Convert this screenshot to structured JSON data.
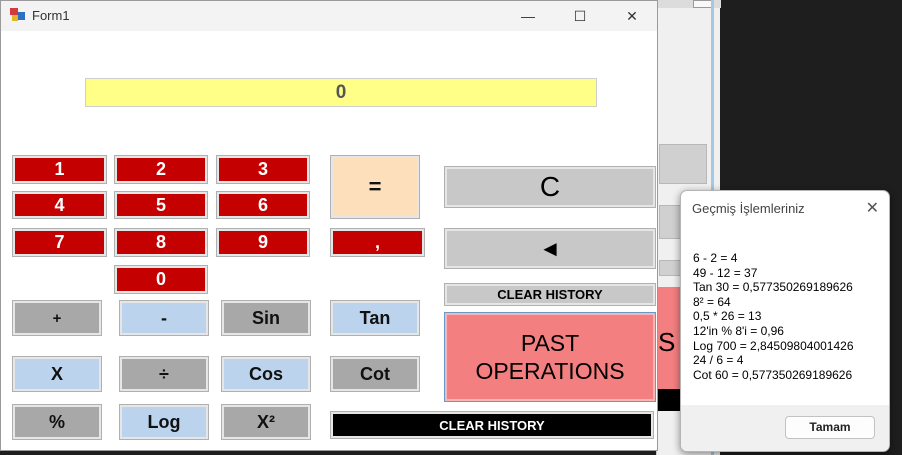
{
  "window": {
    "title": "Form1"
  },
  "title_controls": {
    "minimize": "—",
    "maximize": "☐",
    "close": "✕"
  },
  "display": {
    "value": "0"
  },
  "numpad": [
    "1",
    "2",
    "3",
    "4",
    "5",
    "6",
    "7",
    "8",
    "9",
    "0"
  ],
  "buttons": {
    "equals": "=",
    "comma": ",",
    "clear": "C",
    "backspace": "◄",
    "clear_history_1": "CLEAR HISTORY",
    "past_operations_line1": "PAST",
    "past_operations_line2": "OPERATIONS",
    "clear_history_2": "CLEAR HISTORY",
    "plus": "+",
    "minus": "-",
    "sin": "Sin",
    "tan": "Tan",
    "multiply": "X",
    "divide": "÷",
    "cos": "Cos",
    "cot": "Cot",
    "percent": "%",
    "log": "Log",
    "square": "X²"
  },
  "dialog": {
    "title": "Geçmiş İşlemleriniz",
    "close": "✕",
    "lines": [
      "6 - 2 = 4",
      "49 - 12 = 37",
      "Tan 30 = 0,577350269189626",
      "8² = 64",
      "0,5 * 26 = 13",
      "12'in % 8'i = 0,96",
      "Log 700 = 2,84509804001426",
      "24 / 6 = 4",
      "Cot 60 = 0,577350269189626"
    ],
    "ok": "Tamam"
  },
  "remnant": {
    "letter": "S"
  },
  "colors": {
    "display_bg": "#ffff88",
    "number_bg": "#c40000",
    "past_ops_bg": "#f47f81"
  }
}
